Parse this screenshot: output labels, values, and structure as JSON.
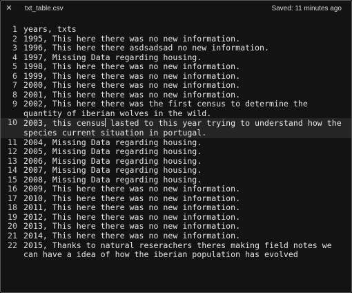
{
  "window": {
    "close_icon": "close-icon",
    "filename": "txt_table.csv",
    "status": "Saved: 11 minutes ago"
  },
  "editor": {
    "current_line": 10,
    "lines": [
      {
        "num": "1",
        "text": "years, txts"
      },
      {
        "num": "2",
        "text": "1995, This here there was no new information."
      },
      {
        "num": "3",
        "text": "1996, This here there asdsadsad no new information."
      },
      {
        "num": "4",
        "text": "1997, Missing Data regarding housing."
      },
      {
        "num": "5",
        "text": "1998, This here there was no new information."
      },
      {
        "num": "6",
        "text": "1999, This here there was no new information."
      },
      {
        "num": "7",
        "text": "2000, This here there was no new information."
      },
      {
        "num": "8",
        "text": "2001, This here there was no new information."
      },
      {
        "num": "9",
        "text": "2002, This here there was the first census to determine the quantity of iberian wolves in the wild."
      },
      {
        "num": "10",
        "text_before_cursor": "2003, this census",
        "text_after_cursor": " lasted to this year trying to understand how the species current situation in portugal."
      },
      {
        "num": "11",
        "text": "2004, Missing Data regarding housing."
      },
      {
        "num": "12",
        "text": "2005, Missing Data regarding housing."
      },
      {
        "num": "13",
        "text": "2006, Missing Data regarding housing."
      },
      {
        "num": "14",
        "text": "2007, Missing Data regarding housing."
      },
      {
        "num": "15",
        "text": "2008, Missing Data regarding housing."
      },
      {
        "num": "16",
        "text": "2009, This here there was no new information."
      },
      {
        "num": "17",
        "text": "2010, This here there was no new information."
      },
      {
        "num": "18",
        "text": "2011, This here there was no new information."
      },
      {
        "num": "19",
        "text": "2012, This here there was no new information."
      },
      {
        "num": "20",
        "text": "2013, This here there was no new information."
      },
      {
        "num": "21",
        "text": "2014, This here there was no new information."
      },
      {
        "num": "22",
        "text": "2015, Thanks to natural reserachers theres making field notes we can have a idea of how the iberian population has evolved"
      }
    ]
  }
}
